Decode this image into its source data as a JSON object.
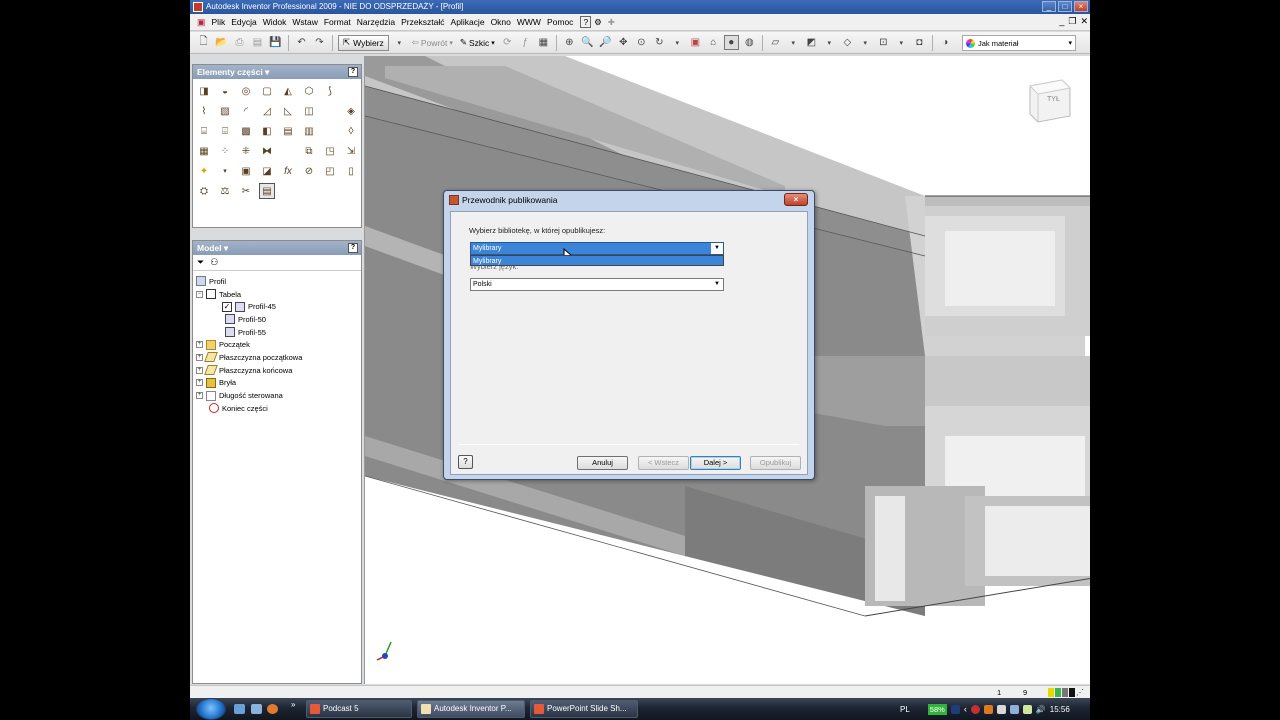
{
  "window": {
    "title": "Autodesk Inventor Professional 2009 - NIE DO ODSPRZEDAŻY - [Profil]",
    "buttons": [
      "_",
      "□",
      "×"
    ]
  },
  "menubar": {
    "items": [
      "Plik",
      "Edycja",
      "Widok",
      "Wstaw",
      "Format",
      "Narzędzia",
      "Przekształć",
      "Aplikacje",
      "Okno",
      "WWW",
      "Pomoc"
    ]
  },
  "toolbar": {
    "select_label": "Wybierz",
    "back_label": "Powrót",
    "sketch_label": "Szkic",
    "material_value": "Jak materiał"
  },
  "panels": {
    "parts_title": "Elementy części ▾",
    "model_title": "Model ▾",
    "help": "?"
  },
  "tree": {
    "items": [
      {
        "label": "Profil",
        "icon": "part"
      },
      {
        "label": "Tabela",
        "icon": "table"
      },
      {
        "label": "Profil-45",
        "icon": "cfg"
      },
      {
        "label": "Profil-50",
        "icon": "cfg"
      },
      {
        "label": "Profil-55",
        "icon": "cfg"
      },
      {
        "label": "Początek",
        "icon": "folder"
      },
      {
        "label": "Płaszczyzna początkowa",
        "icon": "plane"
      },
      {
        "label": "Płaszczyzna końcowa",
        "icon": "plane"
      },
      {
        "label": "Bryła",
        "icon": "solid"
      },
      {
        "label": "Długość sterowana",
        "icon": "param"
      },
      {
        "label": "Koniec części",
        "icon": "end"
      }
    ]
  },
  "viewcube": {
    "label": "TYŁ"
  },
  "dialog": {
    "title": "Przewodnik publikowania",
    "close": "×",
    "library_label": "Wybierz bibliotekę, w której opublikujesz:",
    "library_value": "Mylibrary",
    "library_option": "Mylibrary",
    "language_label": "Wybierz język:",
    "language_value": "Polski",
    "help": "?",
    "cancel": "Anuluj",
    "back": "< Wstecz",
    "next": "Dalej >",
    "publish": "Opublikuj"
  },
  "statusbar": {
    "num1": "1",
    "num2": "9"
  },
  "taskbar": {
    "tasks": [
      "Podcast 5",
      "Autodesk Inventor P...",
      "PowerPoint Slide Sh..."
    ],
    "lang": "PL",
    "battery": "58%",
    "clock": "15:56",
    "more": "»"
  },
  "colors": {
    "title_bar": "#2a559e",
    "panel_head": "#8a9db6",
    "selection": "#3b84d8",
    "dialog_frame": "#c4d4ea"
  }
}
